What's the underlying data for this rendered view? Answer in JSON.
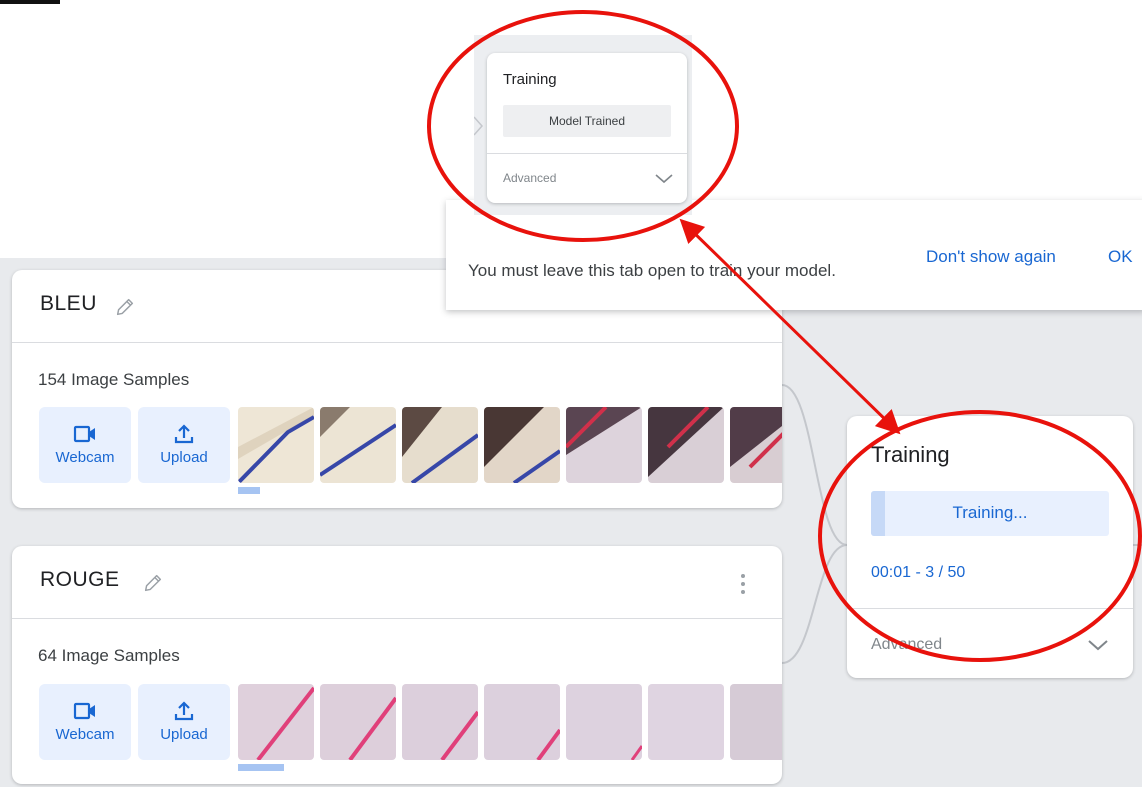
{
  "classes": [
    {
      "name": "BLEU",
      "samples_label": "154 Image Samples",
      "webcam_label": "Webcam",
      "upload_label": "Upload"
    },
    {
      "name": "ROUGE",
      "samples_label": "64 Image Samples",
      "webcam_label": "Webcam",
      "upload_label": "Upload"
    }
  ],
  "training": {
    "title": "Training",
    "progress_label": "Training...",
    "progress_fraction": 0.06,
    "epoch_text": "00:01 - 3 / 50",
    "advanced_label": "Advanced"
  },
  "toast": {
    "message": "You must leave this tab open to train your model.",
    "dont_show_label": "Don't show again",
    "ok_label": "OK"
  },
  "inset": {
    "title": "Training",
    "status_label": "Model Trained",
    "advanced_label": "Advanced"
  },
  "colors": {
    "accent": "#1967d2",
    "annotation": "#e8120c",
    "canvas": "#e8eaed"
  }
}
